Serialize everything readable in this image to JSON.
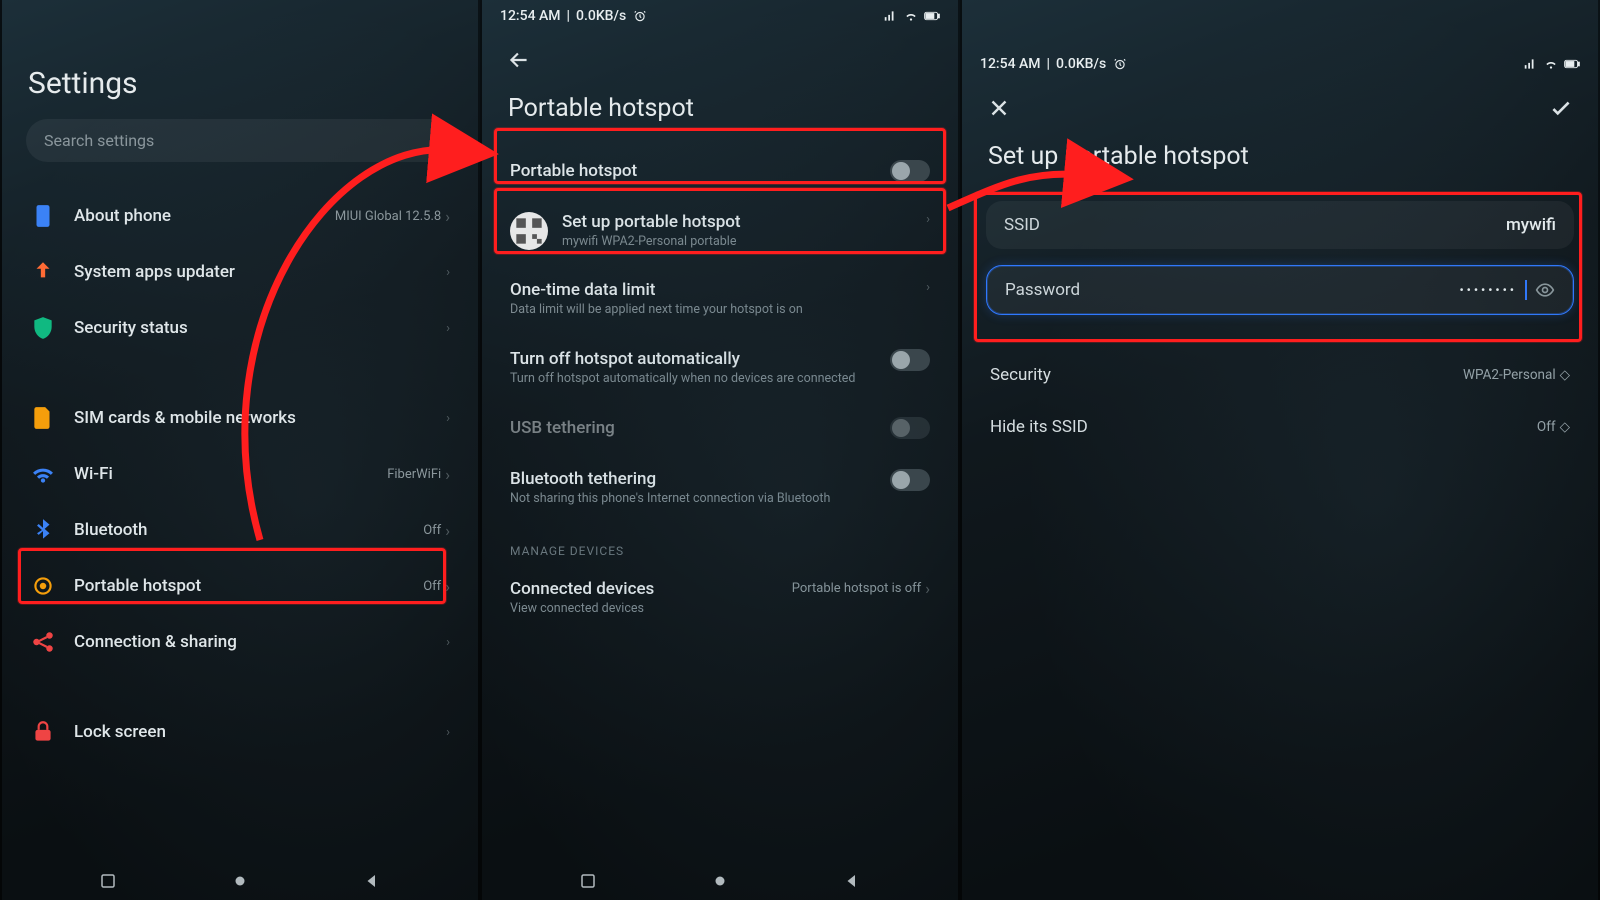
{
  "status": {
    "time": "12:54 AM",
    "net": "0.0KB/s",
    "alarm_icon": "alarm",
    "carrier_icon": "signal",
    "wifi_icon": "wifi",
    "battery_icon": "battery"
  },
  "screen1": {
    "title": "Settings",
    "search_placeholder": "Search settings",
    "items": [
      {
        "icon": "about",
        "label": "About phone",
        "trail": "MIUI Global 12.5.8"
      },
      {
        "icon": "updater",
        "label": "System apps updater",
        "trail": ""
      },
      {
        "icon": "security",
        "label": "Security status",
        "trail": ""
      }
    ],
    "network_items": [
      {
        "icon": "sim",
        "label": "SIM cards & mobile networks",
        "trail": ""
      },
      {
        "icon": "wifi",
        "label": "Wi-Fi",
        "trail": "FiberWiFi"
      },
      {
        "icon": "bluetooth",
        "label": "Bluetooth",
        "trail": "Off"
      },
      {
        "icon": "hotspot",
        "label": "Portable hotspot",
        "trail": "Off"
      },
      {
        "icon": "share",
        "label": "Connection & sharing",
        "trail": ""
      }
    ],
    "personal_items": [
      {
        "icon": "lock",
        "label": "Lock screen",
        "trail": ""
      }
    ]
  },
  "screen2": {
    "title": "Portable hotspot",
    "rows": {
      "toggle": {
        "label": "Portable hotspot"
      },
      "setup": {
        "label": "Set up portable hotspot",
        "sub": "mywifi WPA2-Personal portable"
      },
      "limit": {
        "label": "One-time data limit",
        "sub": "Data limit will be applied next time your hotspot is on"
      },
      "auto": {
        "label": "Turn off hotspot automatically",
        "sub": "Turn off hotspot automatically when no devices are connected"
      },
      "usb": {
        "label": "USB tethering"
      },
      "bt": {
        "label": "Bluetooth tethering",
        "sub": "Not sharing this phone's Internet connection via Bluetooth"
      }
    },
    "section": "MANAGE DEVICES",
    "connected": {
      "label": "Connected devices",
      "sub": "View connected devices",
      "trail": "Portable hotspot is off"
    }
  },
  "screen3": {
    "title": "Set up portable hotspot",
    "ssid_label": "SSID",
    "ssid_value": "mywifi",
    "password_label": "Password",
    "password_masked": "••••••••",
    "security_label": "Security",
    "security_value": "WPA2-Personal",
    "hide_label": "Hide its SSID",
    "hide_value": "Off"
  },
  "annotation_color": "#ff1e1e"
}
